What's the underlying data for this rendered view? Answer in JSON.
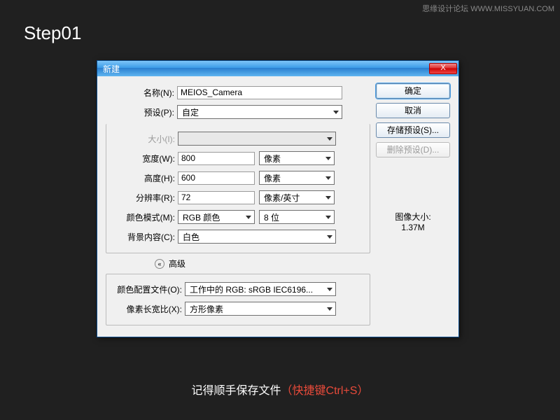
{
  "watermark": "思缘设计论坛  WWW.MISSYUAN.COM",
  "step_title": "Step01",
  "dialog": {
    "title": "新建",
    "close": "X",
    "labels": {
      "name": "名称(N):",
      "preset": "预设(P):",
      "size": "大小(I):",
      "width": "宽度(W):",
      "height": "高度(H):",
      "resolution": "分辨率(R):",
      "color_mode": "颜色模式(M):",
      "bg": "背景内容(C):",
      "advanced": "高级",
      "color_profile": "颜色配置文件(O):",
      "pixel_aspect": "像素长宽比(X):"
    },
    "values": {
      "name": "MEIOS_Camera",
      "preset": "自定",
      "size": "",
      "width": "800",
      "width_unit": "像素",
      "height": "600",
      "height_unit": "像素",
      "resolution": "72",
      "resolution_unit": "像素/英寸",
      "color_mode": "RGB 颜色",
      "bit_depth": "8 位",
      "bg": "白色",
      "color_profile": "工作中的 RGB: sRGB IEC6196...",
      "pixel_aspect": "方形像素"
    },
    "buttons": {
      "ok": "确定",
      "cancel": "取消",
      "save_preset": "存储预设(S)...",
      "delete_preset": "删除预设(D)..."
    },
    "image_size_label": "图像大小:",
    "image_size_value": "1.37M"
  },
  "tip": {
    "white": "记得顺手保存文件",
    "red": "（快捷键Ctrl+S）"
  }
}
